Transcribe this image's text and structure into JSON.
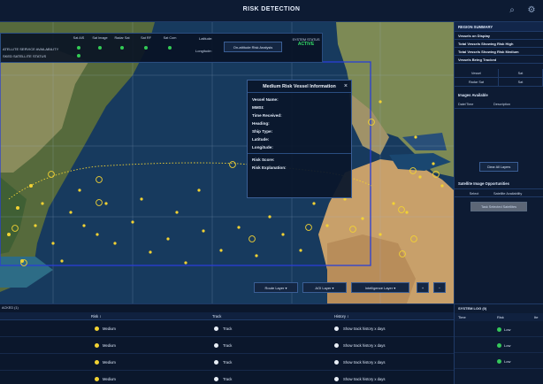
{
  "topbar": {
    "title": "RISK DETECTION",
    "search_icon": "search-icon",
    "settings_icon": "gear-icon"
  },
  "status_panel": {
    "line1": "ATELLITE SERVICE AVAILABILITY",
    "line2": "SKED SATELLITE STATUS",
    "columns": [
      "Sat AIS",
      "Sat Image",
      "Radar Sat",
      "Sat RF",
      "Sat Com"
    ],
    "latitude_label": "Latitude:",
    "longitude_label": "Longitude:",
    "button": "On-attitude Risk Analysis",
    "system_status_label": "SYSTEM STATUS",
    "system_status_value": "ACTIVE",
    "status_color": "#33cc55"
  },
  "popup": {
    "title": "Medium Risk Vessel Information",
    "close": "×",
    "fields": [
      "Vessel Name:",
      "MMSI:",
      "Time Received:",
      "Heading:",
      "Ship Type:",
      "Latitude:",
      "Longitude:"
    ],
    "risk_fields": [
      "Risk Score:",
      "Risk Explanation:"
    ]
  },
  "sidebar": {
    "header": "REGION SUMMARY",
    "summary": [
      "Vessels on Display",
      "Total Vessels Showing Risk High",
      "Total Vessels Showing Risk Medium",
      "Vessels Being Tracked"
    ],
    "tabs_row1": [
      "Vessel",
      "Sat"
    ],
    "tabs_row2": [
      "Radar Sat",
      "Sat"
    ],
    "images_header": "Images Available",
    "image_cols": [
      "Date/Time",
      "Description"
    ],
    "clear_button": "Clear All Layers",
    "satellite_header": "Satellite Image Opportunities",
    "sat_cols": [
      "Select",
      "Satellite Availability"
    ],
    "task_button": "Task Selected Satellites"
  },
  "layers": {
    "route": "Route Layer",
    "aoi": "AOI Layer",
    "intel": "Intelligence Layer",
    "plus": "+",
    "minus": "−"
  },
  "bottom_table": {
    "title": "ACKED (1)",
    "headers": [
      "Risk",
      "Track",
      "History"
    ],
    "sort_icon": "↕",
    "rows": [
      {
        "risk": "Medium",
        "track": "Track",
        "history": "Show track history x days"
      },
      {
        "risk": "Medium",
        "track": "Track",
        "history": "Show track history x days"
      },
      {
        "risk": "Medium",
        "track": "Track",
        "history": "Show track history x days"
      },
      {
        "risk": "Medium",
        "track": "Track",
        "history": "Show track history x days"
      }
    ]
  },
  "system_log": {
    "title": "SYSTEM LOG (0)",
    "headers": [
      "Time",
      "Risk",
      "Ite"
    ],
    "rows": [
      "Low",
      "Low",
      "Low"
    ]
  },
  "colors": {
    "accent": "#3a5e95",
    "medium_risk": "#f2d233",
    "low_risk": "#35c85a",
    "selection": "#2a3fd6"
  }
}
